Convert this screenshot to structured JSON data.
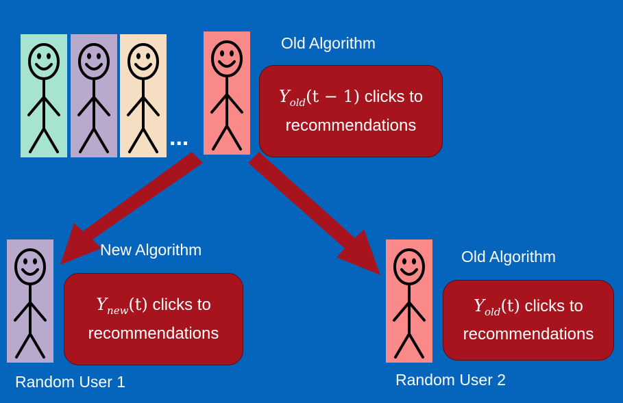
{
  "colors": {
    "background": "#0565BC",
    "box_fill": "#A8141D",
    "arrow": "#A8141D",
    "user_teal": "#A6E3D0",
    "user_purple": "#B9A9CC",
    "user_peach": "#F5DEC2",
    "user_pink": "#FA8A8A"
  },
  "top": {
    "label": "Old Algorithm",
    "ellipsis": "...",
    "box": {
      "var": "Y",
      "sub": "old",
      "arg": "(t − 1)",
      "line1_rest": " clicks to",
      "line2": "recommendations"
    }
  },
  "left": {
    "label": "New Algorithm",
    "box": {
      "var": "Y",
      "sub": "new",
      "arg": "(t)",
      "line1_rest": " clicks to",
      "line2": "recommendations"
    },
    "caption": "Random User 1"
  },
  "right": {
    "label": "Old Algorithm",
    "box": {
      "var": "Y",
      "sub": "old",
      "arg": "(t)",
      "line1_rest": " clicks to",
      "line2": "recommendations"
    },
    "caption": "Random User 2"
  },
  "icons": [
    "stick-figure-icon",
    "arrow-icon"
  ]
}
